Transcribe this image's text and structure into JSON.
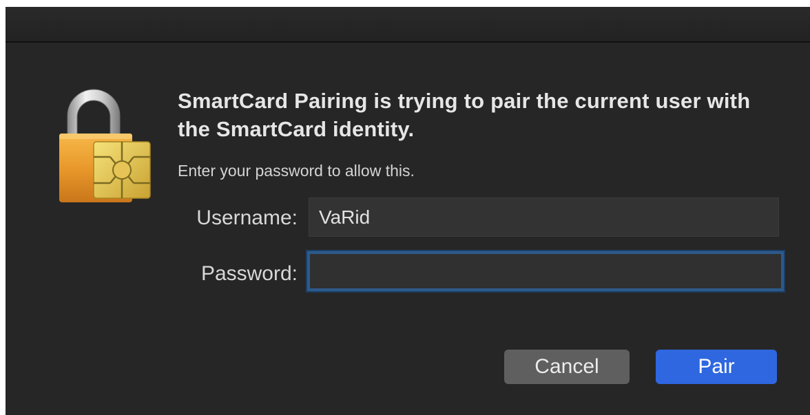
{
  "dialog": {
    "heading": "SmartCard Pairing is trying to pair the current user with the SmartCard identity.",
    "subheading": "Enter your password to allow this.",
    "icon": "padlock-smartcard-chip-icon",
    "username_label": "Username:",
    "username_value": "VaRid",
    "password_label": "Password:",
    "password_value": "",
    "cancel_label": "Cancel",
    "pair_label": "Pair"
  },
  "colors": {
    "background": "#262626",
    "accent": "#2f67e0",
    "focus_ring": "#2d5a8c",
    "cancel_button": "#5f5f5f"
  }
}
